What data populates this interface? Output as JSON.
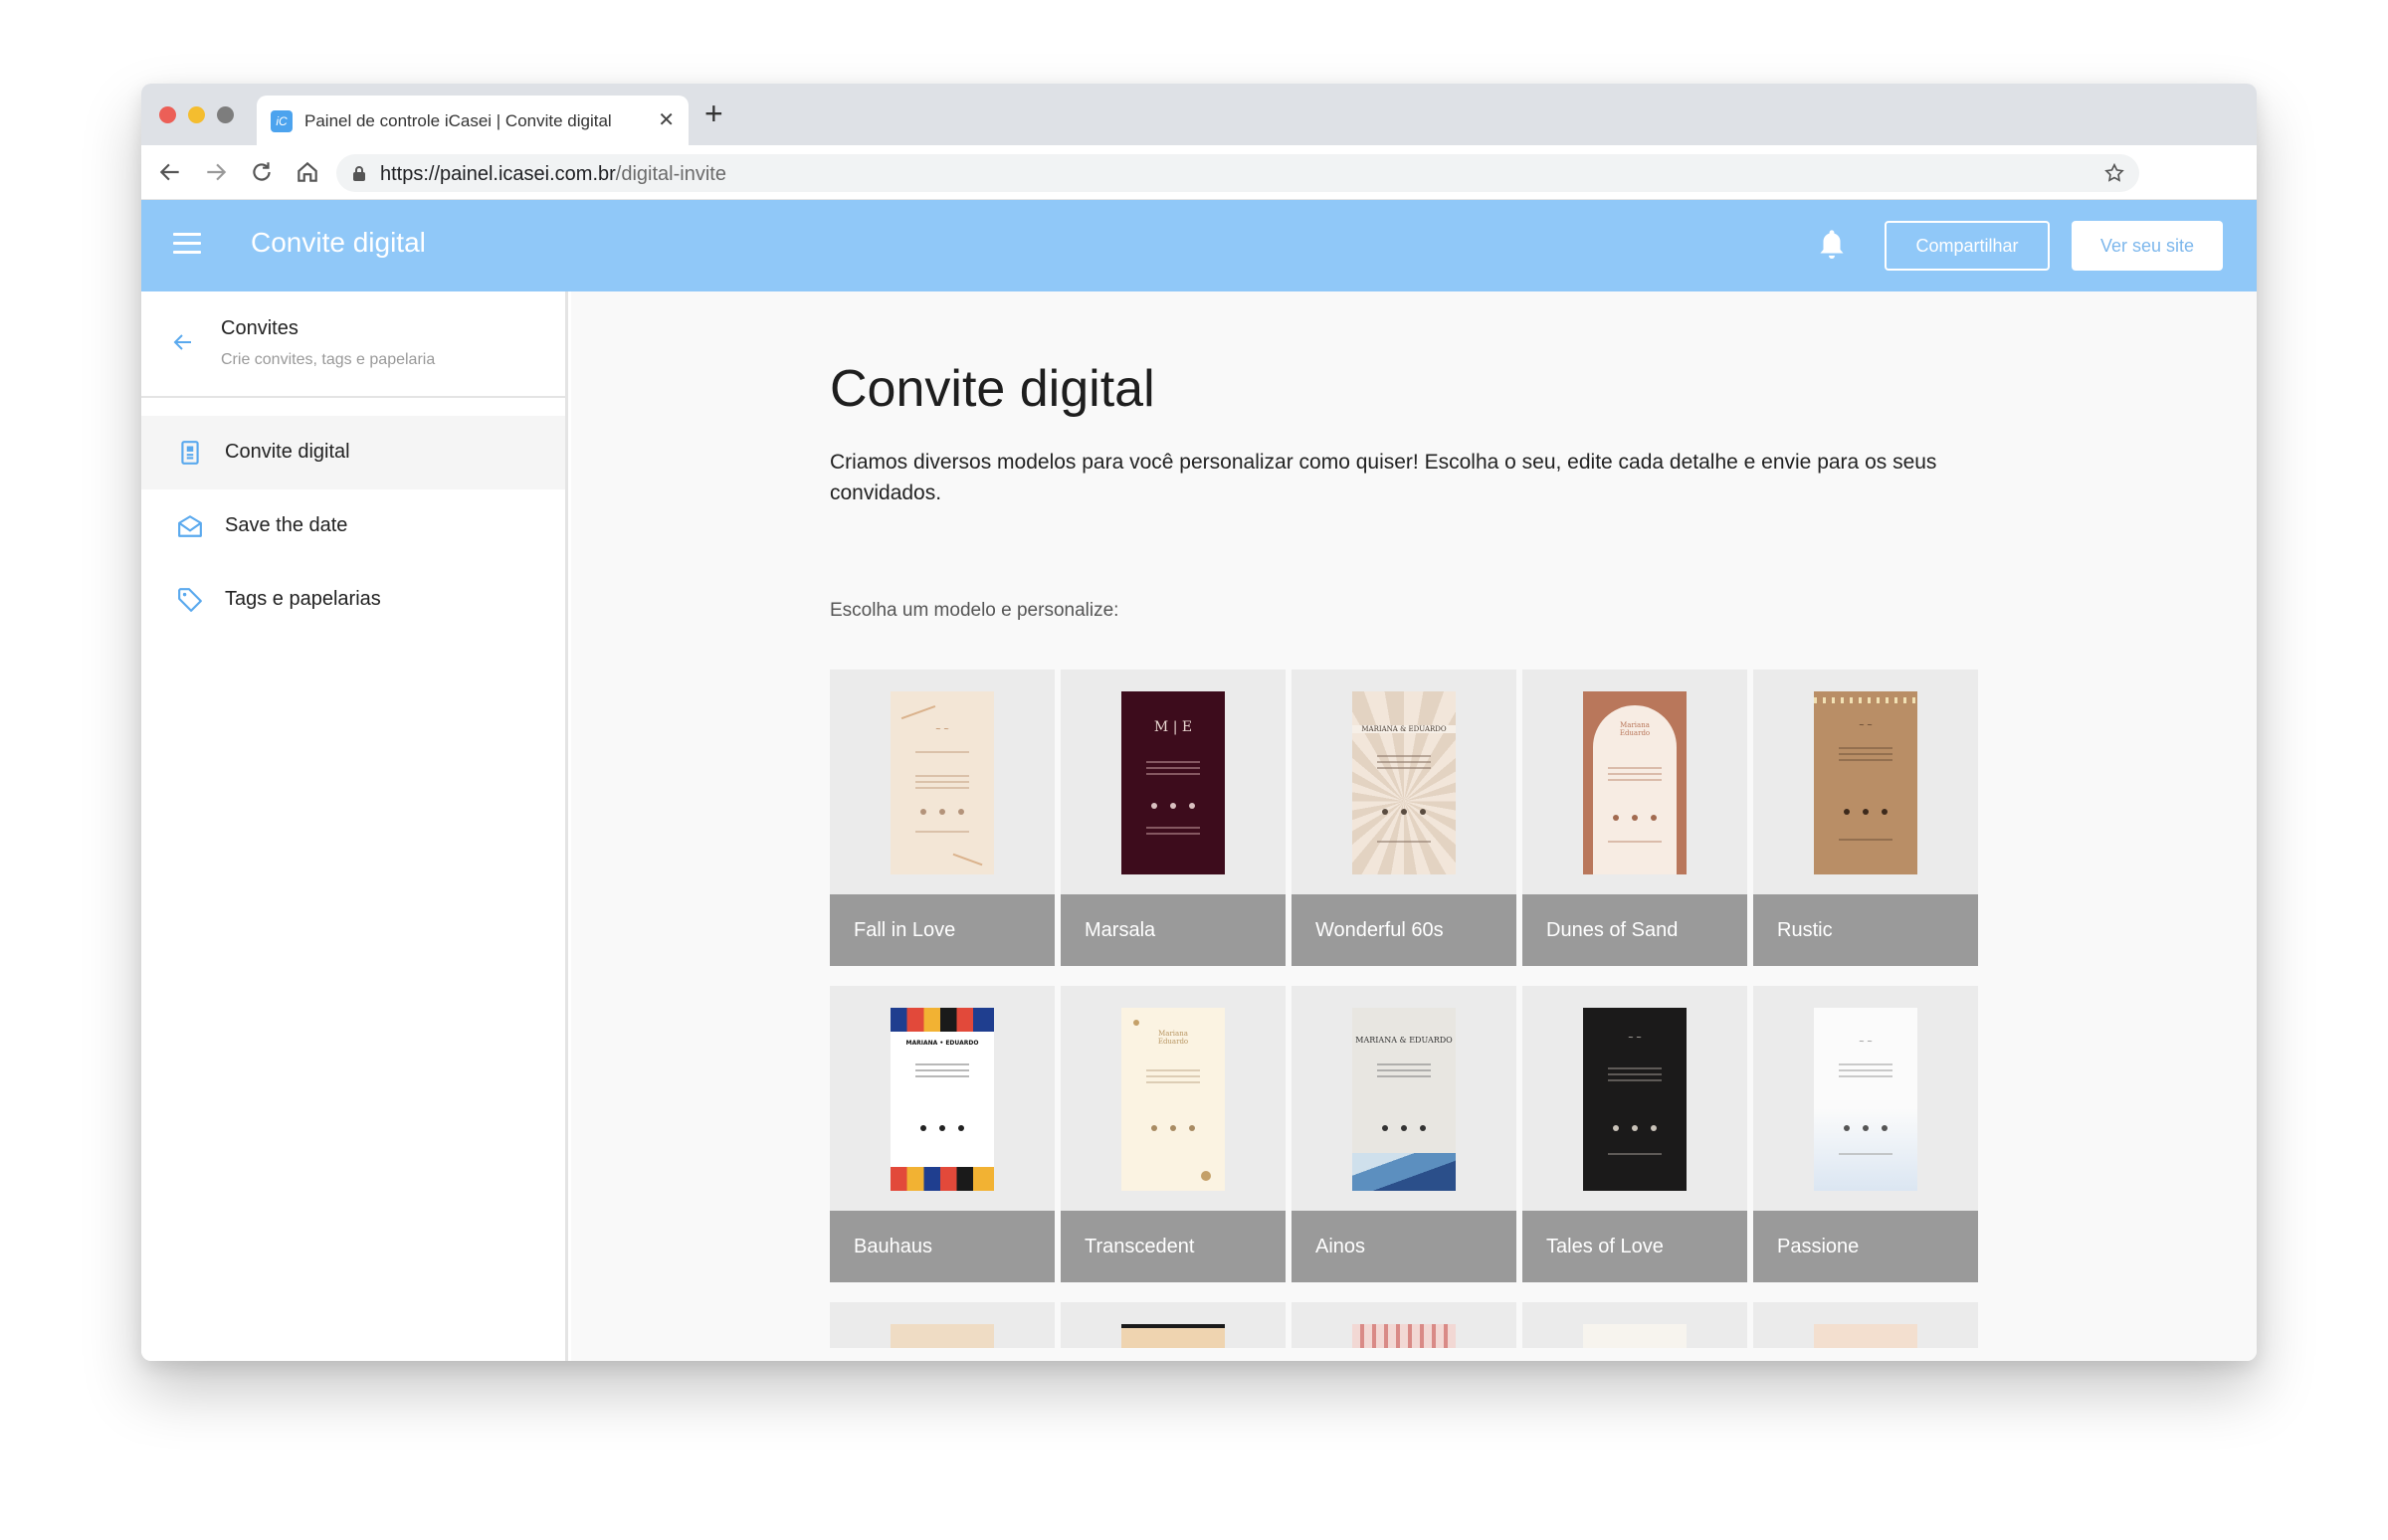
{
  "browser": {
    "tab_title": "Painel de controle iCasei | Convite digital",
    "favicon_text": "iC",
    "url_host": "https://painel.icasei.com.br",
    "url_path": "/digital-invite"
  },
  "header": {
    "title": "Convite digital",
    "share_label": "Compartilhar",
    "site_label": "Ver seu site",
    "accent_color": "#90c8f8"
  },
  "sidebar": {
    "title": "Convites",
    "subtitle": "Crie convites, tags e papelaria",
    "items": [
      {
        "label": "Convite digital",
        "icon": "invite-icon",
        "active": true
      },
      {
        "label": "Save the date",
        "icon": "envelope-icon",
        "active": false
      },
      {
        "label": "Tags e papelarias",
        "icon": "tag-icon",
        "active": false
      }
    ]
  },
  "main": {
    "title": "Convite digital",
    "description": "Criamos diversos modelos para você personalizar como quiser! Escolha o seu, edite cada detalhe e envie para os seus convidados.",
    "choose_label": "Escolha um modelo e personalize:",
    "templates": [
      {
        "name": "Fall in Love"
      },
      {
        "name": "Marsala"
      },
      {
        "name": "Wonderful 60s"
      },
      {
        "name": "Dunes of Sand"
      },
      {
        "name": "Rustic"
      },
      {
        "name": "Bauhaus",
        "thumb_title": "MARIANA • EDUARDO"
      },
      {
        "name": "Transcedent"
      },
      {
        "name": "Ainos",
        "thumb_title": "MARIANA & EDUARDO"
      },
      {
        "name": "Tales of Love"
      },
      {
        "name": "Passione"
      }
    ]
  }
}
